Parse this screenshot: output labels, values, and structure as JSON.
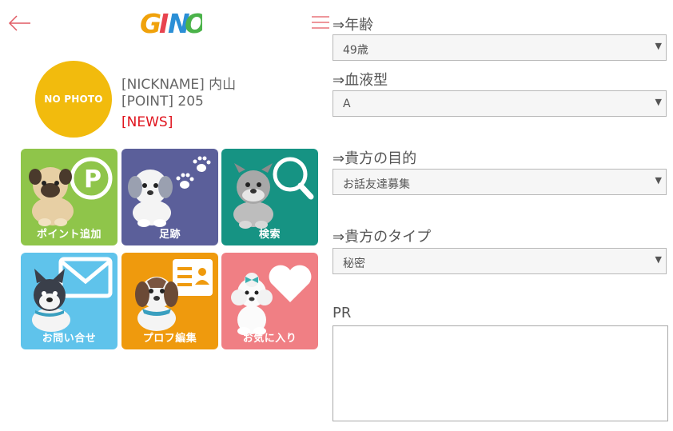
{
  "header": {
    "logo_text": "GINO"
  },
  "profile": {
    "avatar_text": "NO PHOTO",
    "nickname_line": "[NICKNAME] 内山",
    "point_line": "[POINT] 205",
    "news_line": "[NEWS]"
  },
  "tiles": [
    {
      "label": "ポイント追加",
      "color": "#8fc54a",
      "icon": "point-p-icon"
    },
    {
      "label": "足跡",
      "color": "#5b5f9a",
      "icon": "paw-print-icon"
    },
    {
      "label": "検索",
      "color": "#169383",
      "icon": "magnifier-icon"
    },
    {
      "label": "お問い合せ",
      "color": "#5fc3eb",
      "icon": "mail-icon"
    },
    {
      "label": "プロフ編集",
      "color": "#ef9a0d",
      "icon": "profile-card-icon"
    },
    {
      "label": "お気に入り",
      "color": "#f07f84",
      "icon": "heart-icon"
    }
  ],
  "form": {
    "age": {
      "label": "⇒年齢",
      "value": "49歳"
    },
    "blood": {
      "label": "⇒血液型",
      "value": "A"
    },
    "purpose": {
      "label": "⇒貴方の目的",
      "value": "お話友達募集"
    },
    "type": {
      "label": "⇒貴方のタイプ",
      "value": "秘密"
    },
    "pr": {
      "label": "PR",
      "value": ""
    }
  },
  "colors": {
    "accent_red": "#e0141e",
    "avatar_yellow": "#f2bb0d",
    "menu_icon": "#e8737a"
  }
}
